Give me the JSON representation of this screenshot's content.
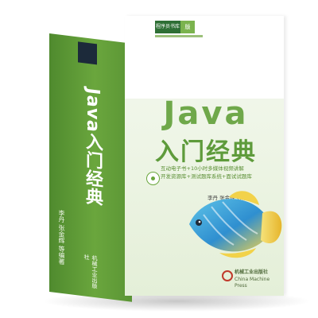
{
  "book": {
    "title_latin": "Java",
    "title_cn": "入门经典",
    "spine_title": "Java入门经典",
    "series_box": "程序员书库",
    "series_tag": "版",
    "spine_authors": "李丹  张金辉  等编著",
    "spine_publisher": "机械工业出版社",
    "features": [
      "互动电子书+10小时多媒体视频讲解",
      "开发资源库+测试题库系统+面试试题库"
    ],
    "authors": "李丹  张金辉  等编著",
    "blurb": [
      {
        "head": "",
        "text": ""
      }
    ],
    "publisher_cn": "机械工业出版社",
    "publisher_en": "China Machine Press"
  },
  "colors": {
    "spine": "#6aa63d",
    "title_latin": "#6fa84a",
    "title_cn": "#5e9b3b"
  }
}
